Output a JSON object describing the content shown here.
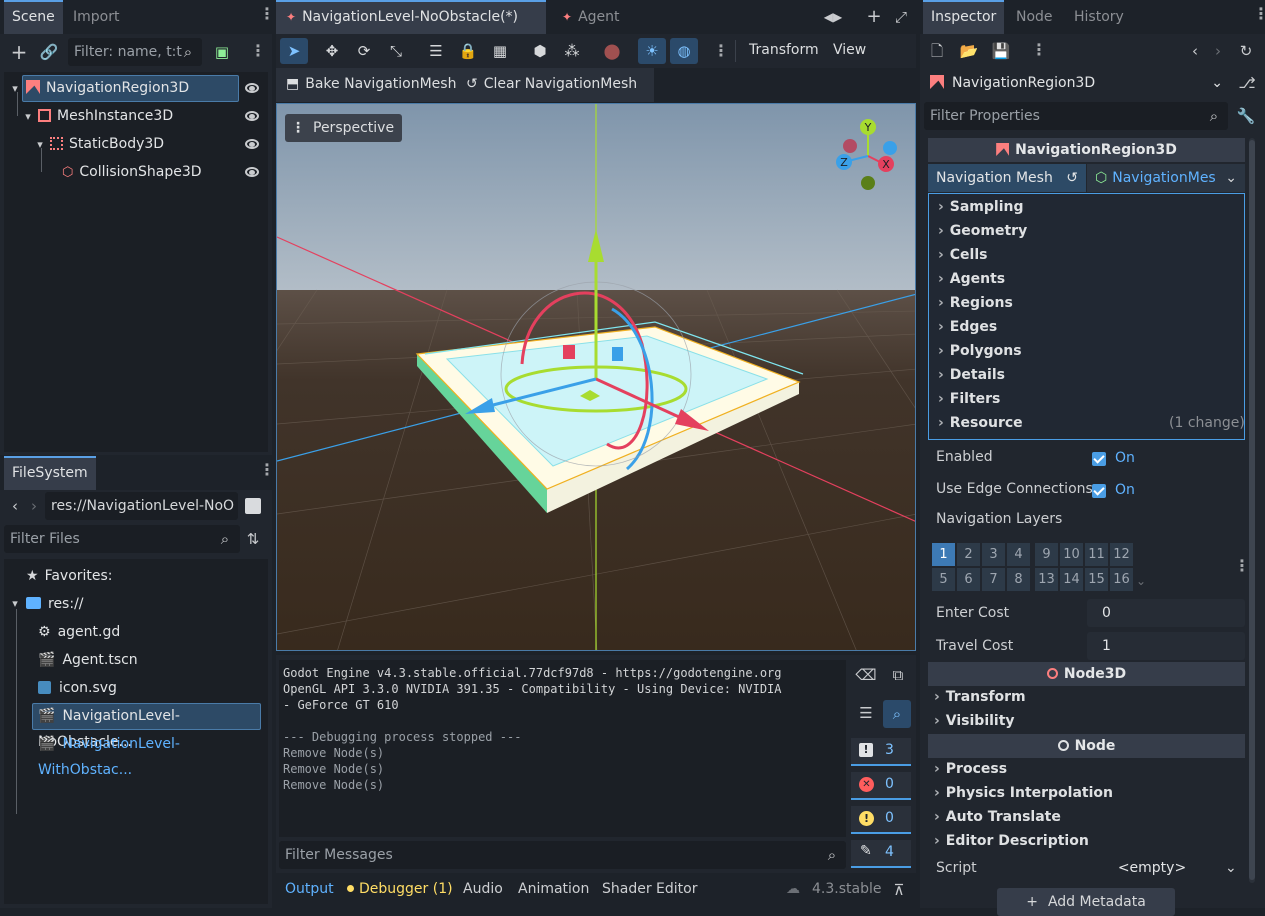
{
  "scene_dock": {
    "tabs": [
      "Scene",
      "Import"
    ],
    "filter_placeholder": "Filter: name, t:t",
    "tree": [
      {
        "label": "NavigationRegion3D"
      },
      {
        "label": "MeshInstance3D"
      },
      {
        "label": "StaticBody3D"
      },
      {
        "label": "CollisionShape3D"
      }
    ]
  },
  "filesystem_dock": {
    "tab": "FileSystem",
    "path": "res://NavigationLevel-NoO",
    "filter_placeholder": "Filter Files",
    "favorites": "Favorites:",
    "root": "res://",
    "files": [
      {
        "label": "agent.gd"
      },
      {
        "label": "Agent.tscn"
      },
      {
        "label": "icon.svg"
      },
      {
        "label": "NavigationLevel-NoObstacle..."
      },
      {
        "label": "NavigationLevel-WithObstac..."
      }
    ]
  },
  "editor": {
    "tabs": [
      "NavigationLevel-NoObstacle(*)",
      "Agent"
    ],
    "toolbar_menus": {
      "transform": "Transform",
      "view": "View"
    },
    "bake_button": "Bake NavigationMesh",
    "clear_button": "Clear NavigationMesh",
    "viewport_label": "Perspective",
    "gizmo_axes": {
      "y": "Y",
      "z": "Z",
      "x": "X"
    }
  },
  "output": {
    "lines": [
      "Godot Engine v4.3.stable.official.77dcf97d8 - https://godotengine.org",
      "OpenGL API 3.3.0 NVIDIA 391.35 - Compatibility - Using Device: NVIDIA",
      "- GeForce GT 610",
      "",
      "--- Debugging process stopped ---",
      "Remove Node(s)",
      "Remove Node(s)",
      "Remove Node(s)"
    ],
    "filter_placeholder": "Filter Messages",
    "counts": {
      "messages": "3",
      "errors": "0",
      "warnings": "0",
      "editor": "4"
    },
    "bottom_tabs": [
      "Output",
      "Debugger (1)",
      "Audio",
      "Animation",
      "Shader Editor"
    ],
    "version": "4.3.stable"
  },
  "inspector": {
    "tabs": [
      "Inspector",
      "Node",
      "History"
    ],
    "node_name": "NavigationRegion3D",
    "filter_placeholder": "Filter Properties",
    "section_title": "NavigationRegion3D",
    "navmesh_label": "Navigation Mesh",
    "navmesh_value": "NavigationMes",
    "subgroups": [
      "Sampling",
      "Geometry",
      "Cells",
      "Agents",
      "Regions",
      "Edges",
      "Polygons",
      "Details",
      "Filters",
      "Resource"
    ],
    "resource_change": "(1 change)",
    "enabled_label": "Enabled",
    "enabled_value": "On",
    "edge_label": "Use Edge Connections",
    "edge_value": "On",
    "layers_label": "Navigation Layers",
    "layers": [
      "1",
      "2",
      "3",
      "4",
      "9",
      "10",
      "11",
      "12",
      "5",
      "6",
      "7",
      "8",
      "13",
      "14",
      "15",
      "16"
    ],
    "enter_cost_label": "Enter Cost",
    "enter_cost": "0",
    "travel_cost_label": "Travel Cost",
    "travel_cost": "1",
    "node3d_title": "Node3D",
    "node3d_groups": [
      "Transform",
      "Visibility"
    ],
    "node_title": "Node",
    "node_groups": [
      "Process",
      "Physics Interpolation",
      "Auto Translate",
      "Editor Description"
    ],
    "script_label": "Script",
    "script_value": "<empty>",
    "add_metadata": "Add Metadata"
  },
  "colors": {
    "accent": "#4a9de4",
    "navigation": "#fc7f7f",
    "sky": "#a7b8c9",
    "ground": "#3e3023"
  }
}
